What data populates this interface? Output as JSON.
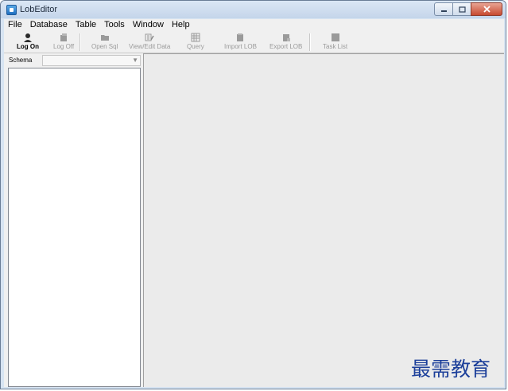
{
  "window": {
    "title": "LobEditor"
  },
  "menu": [
    "File",
    "Database",
    "Table",
    "Tools",
    "Window",
    "Help"
  ],
  "toolbar": {
    "log_on": "Log On",
    "log_off": "Log Off",
    "open_sql": "Open Sql",
    "view_edit": "View/Edit Data",
    "query": "Query",
    "import_lob": "Import LOB",
    "export_lob": "Export LOB",
    "task_list": "Task List"
  },
  "schema": {
    "label": "Schema",
    "value": ""
  },
  "watermark": "最需教育"
}
